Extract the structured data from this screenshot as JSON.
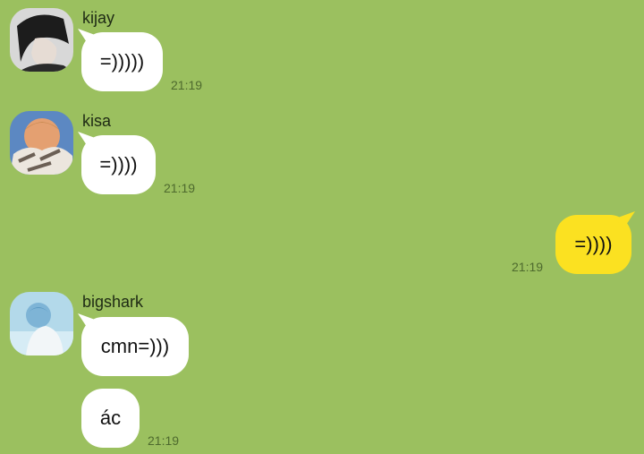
{
  "messages": [
    {
      "sender": "kijay",
      "avatar": "kijay-avatar",
      "texts": [
        "=)))))"
      ],
      "time": "21:19"
    },
    {
      "sender": "kisa",
      "avatar": "kisa-avatar",
      "texts": [
        "=))))"
      ],
      "time": "21:19"
    },
    {
      "sender": "",
      "mine": true,
      "texts": [
        "=))))"
      ],
      "time": "21:19"
    },
    {
      "sender": "bigshark",
      "avatar": "bigshark-avatar",
      "texts": [
        "cmn=)))",
        "ác"
      ],
      "time": "21:19"
    }
  ],
  "colors": {
    "background": "#9bc05f",
    "incoming_bubble": "#ffffff",
    "outgoing_bubble": "#fbe121",
    "timestamp": "#4e6a2e"
  }
}
